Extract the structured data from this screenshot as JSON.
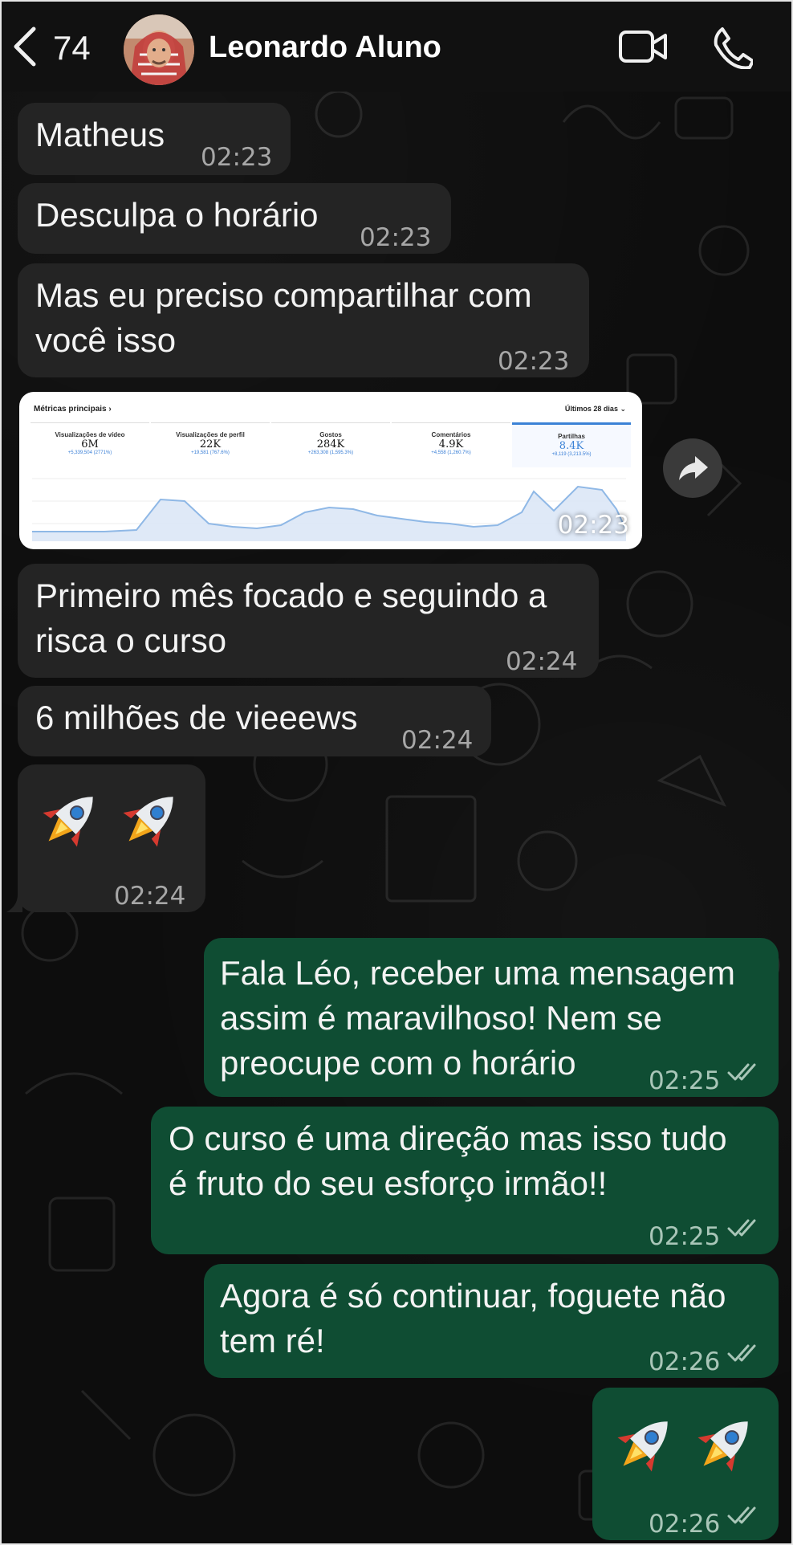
{
  "header": {
    "back_count": "74",
    "contact_name": "Leonardo Aluno"
  },
  "messages": [
    {
      "text": "Matheus",
      "time": "02:23"
    },
    {
      "text": "Desculpa o horário",
      "time": "02:23"
    },
    {
      "text": "Mas eu preciso compartilhar com\nvocê isso",
      "time": "02:23"
    },
    {
      "text": "Primeiro mês focado e seguindo a\nrisca o curso",
      "time": "02:24"
    },
    {
      "text": "6 milhões de vieeews",
      "time": "02:24"
    },
    {
      "text": "",
      "time": "02:24"
    },
    {
      "text": "Fala Léo, receber uma mensagem\nassim é maravilhoso! Nem se\npreocupe com o horário",
      "time": "02:25"
    },
    {
      "text": "O curso é uma direção mas isso tudo\né fruto do seu esforço irmão!!",
      "time": "02:25"
    },
    {
      "text": "Agora é só continuar, foguete não\ntem ré!",
      "time": "02:26"
    },
    {
      "text": "",
      "time": "02:26"
    }
  ],
  "image_message": {
    "time": "02:23",
    "title": "Métricas principais ›",
    "period": "Últimos 28 dias ⌄",
    "metrics": [
      {
        "label": "Visualizações de vídeo",
        "value": "6M",
        "delta": "+5,339,504 (2771%)"
      },
      {
        "label": "Visualizações de perfil",
        "value": "22K",
        "delta": "+19,581 (767.6%)"
      },
      {
        "label": "Gostos",
        "value": "284K",
        "delta": "+263,308 (1,595.3%)"
      },
      {
        "label": "Comentários",
        "value": "4.9K",
        "delta": "+4,558 (1,260.7%)"
      },
      {
        "label": "Partilhas",
        "value": "8.4K",
        "delta": "+8,119 (3,213.5%)"
      }
    ]
  },
  "colors": {
    "incoming": "#242424",
    "outgoing": "#0f4d33",
    "header": "#111111"
  }
}
